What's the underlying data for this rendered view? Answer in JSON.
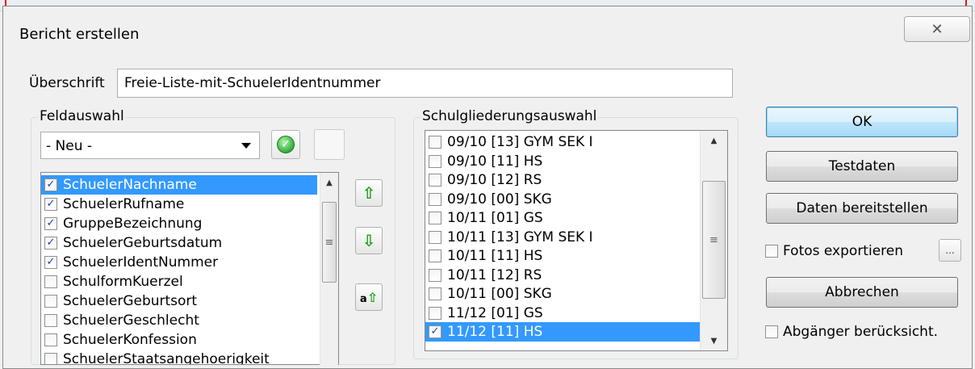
{
  "window": {
    "title": "Bericht erstellen",
    "close_glyph": "✕"
  },
  "header": {
    "title_label": "Überschrift",
    "title_value": "Freie-Liste-mit-SchuelerIdentnummer"
  },
  "feldauswahl": {
    "legend": "Feldauswahl",
    "combo_value": "- Neu -",
    "fields": [
      {
        "label": "SchuelerNachname",
        "checked": true,
        "selected": true
      },
      {
        "label": "SchuelerRufname",
        "checked": true,
        "selected": false
      },
      {
        "label": "GruppeBezeichnung",
        "checked": true,
        "selected": false
      },
      {
        "label": "SchuelerGeburtsdatum",
        "checked": true,
        "selected": false
      },
      {
        "label": "SchuelerIdentNummer",
        "checked": true,
        "selected": false
      },
      {
        "label": "SchulformKuerzel",
        "checked": false,
        "selected": false
      },
      {
        "label": "SchuelerGeburtsort",
        "checked": false,
        "selected": false
      },
      {
        "label": "SchuelerGeschlecht",
        "checked": false,
        "selected": false
      },
      {
        "label": "SchuelerKonfession",
        "checked": false,
        "selected": false
      },
      {
        "label": "SchuelerStaatsangehoerigkeit",
        "checked": false,
        "selected": false
      }
    ]
  },
  "schulgliederung": {
    "legend": "Schulgliederungsauswahl",
    "items": [
      {
        "label": "09/10 [13] GYM SEK I",
        "checked": false,
        "selected": false
      },
      {
        "label": "09/10 [11] HS",
        "checked": false,
        "selected": false
      },
      {
        "label": "09/10 [12] RS",
        "checked": false,
        "selected": false
      },
      {
        "label": "09/10 [00] SKG",
        "checked": false,
        "selected": false
      },
      {
        "label": "10/11 [01] GS",
        "checked": false,
        "selected": false
      },
      {
        "label": "10/11 [13] GYM SEK I",
        "checked": false,
        "selected": false
      },
      {
        "label": "10/11 [11] HS",
        "checked": false,
        "selected": false
      },
      {
        "label": "10/11 [12] RS",
        "checked": false,
        "selected": false
      },
      {
        "label": "10/11 [00] SKG",
        "checked": false,
        "selected": false
      },
      {
        "label": "11/12 [01] GS",
        "checked": false,
        "selected": false
      },
      {
        "label": "11/12 [11] HS",
        "checked": true,
        "selected": true
      }
    ]
  },
  "actions": {
    "ok": "OK",
    "testdaten": "Testdaten",
    "daten_bereitstellen": "Daten bereitstellen",
    "fotos_exportieren": "Fotos exportieren",
    "fotos_checked": false,
    "ellipsis": "...",
    "abbrechen": "Abbrechen",
    "abgaenger": "Abgänger berücksicht.",
    "abgaenger_checked": false
  },
  "icons": {
    "move_up": "up-arrow-icon",
    "move_down": "down-arrow-icon",
    "move_top": "move-to-top-icon",
    "apply": "check-icon"
  }
}
